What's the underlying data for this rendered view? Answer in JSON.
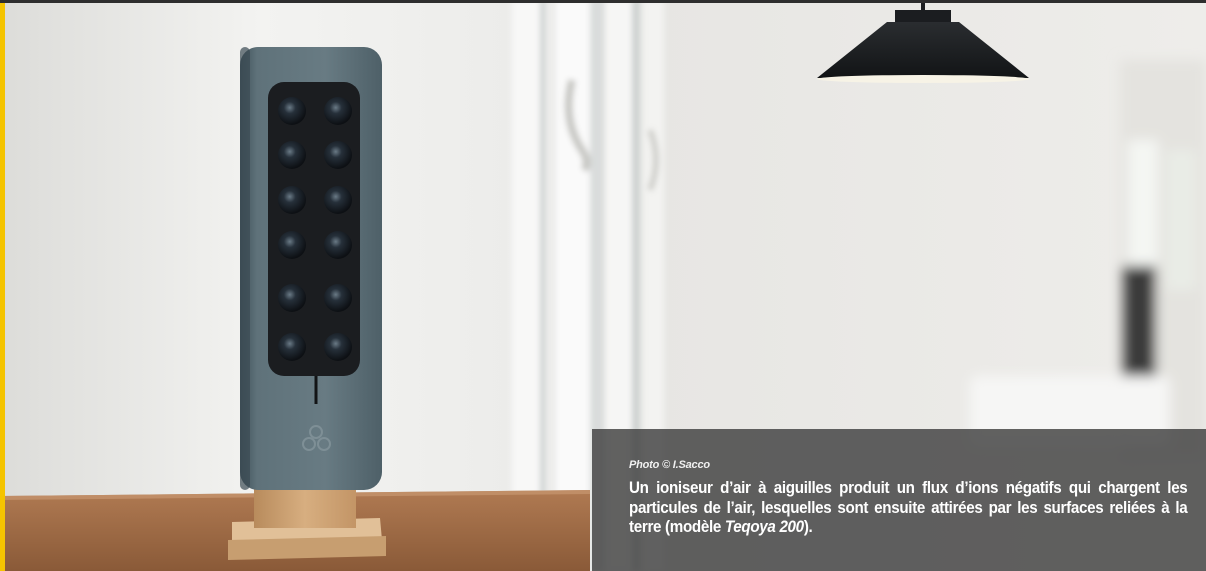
{
  "photo": {
    "subject": "ioniseur d'air Teqoya 200",
    "colors": {
      "yellow_border": "#f5c400",
      "wall": "#ededeb",
      "device_body": "#62757d",
      "needle_panel": "#1b1d20",
      "wood_stand": "#c89a6a",
      "table": "#9b6a45",
      "caption_bg": "#404040"
    }
  },
  "caption": {
    "credit": "Photo © I.Sacco",
    "text_before": "Un ioniseur d’air à aiguilles produit un flux d’ions négatifs qui chargent les particules de l’air, lesquelles sont ensuite attirées par les surfaces reliées à la terre (modèle ",
    "model": "Teqoya 200",
    "text_after": ")."
  }
}
